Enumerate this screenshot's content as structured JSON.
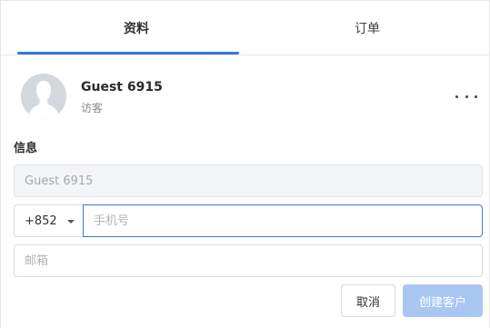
{
  "tabs": [
    {
      "label": "资料",
      "active": true
    },
    {
      "label": "订单",
      "active": false
    }
  ],
  "profile": {
    "name": "Guest 6915",
    "role": "访客"
  },
  "info": {
    "section_title": "信息",
    "name_value": "Guest 6915",
    "country_code": "+852",
    "phone_placeholder": "手机号",
    "email_placeholder": "邮箱"
  },
  "actions": {
    "cancel_label": "取消",
    "create_label": "创建客户"
  },
  "colors": {
    "accent": "#2f7bde",
    "primary_disabled": "#a9c7f1"
  }
}
